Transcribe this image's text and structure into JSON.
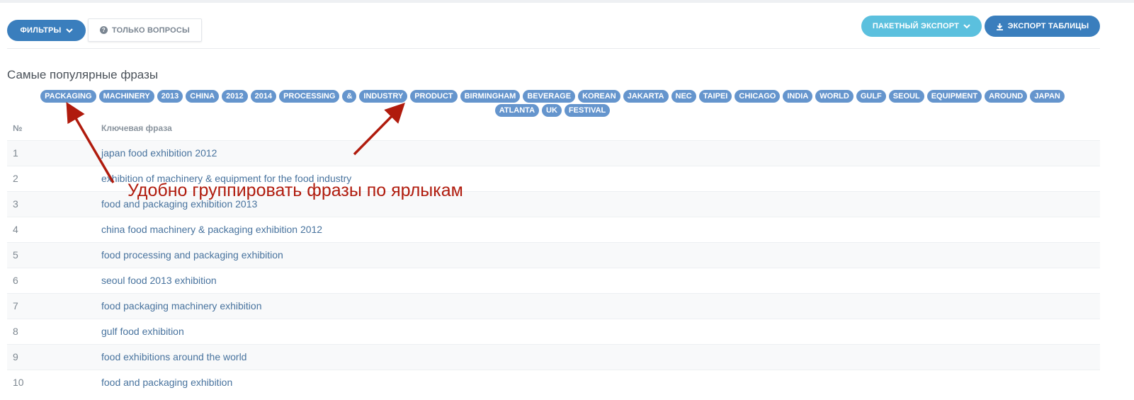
{
  "toolbar": {
    "filters_label": "ФИЛЬТРЫ",
    "questions_only_label": "ТОЛЬКО ВОПРОСЫ",
    "batch_export_label": "ПАКЕТНЫЙ ЭКСПОРТ",
    "export_table_label": "ЭКСПОРТ ТАБЛИЦЫ"
  },
  "popular": {
    "title": "Самые популярные фразы",
    "tags": [
      "PACKAGING",
      "MACHINERY",
      "2013",
      "CHINA",
      "2012",
      "2014",
      "PROCESSING",
      "&",
      "INDUSTRY",
      "PRODUCT",
      "BIRMINGHAM",
      "BEVERAGE",
      "KOREAN",
      "JAKARTA",
      "NEC",
      "TAIPEI",
      "CHICAGO",
      "INDIA",
      "WORLD",
      "GULF",
      "SEOUL",
      "EQUIPMENT",
      "AROUND",
      "JAPAN",
      "ATLANTA",
      "UK",
      "FESTIVAL"
    ]
  },
  "table": {
    "columns": [
      "№",
      "Ключевая фраза"
    ],
    "rows": [
      {
        "num": "1",
        "phrase": "japan food exhibition 2012"
      },
      {
        "num": "2",
        "phrase": "exhibition of machinery & equipment for the food industry"
      },
      {
        "num": "3",
        "phrase": "food and packaging exhibition 2013"
      },
      {
        "num": "4",
        "phrase": "china food machinery & packaging exhibition 2012"
      },
      {
        "num": "5",
        "phrase": "food processing and packaging exhibition"
      },
      {
        "num": "6",
        "phrase": "seoul food 2013 exhibition"
      },
      {
        "num": "7",
        "phrase": "food packaging machinery exhibition"
      },
      {
        "num": "8",
        "phrase": "gulf food exhibition"
      },
      {
        "num": "9",
        "phrase": "food exhibitions around the world"
      },
      {
        "num": "10",
        "phrase": "food and packaging exhibition"
      }
    ]
  },
  "annotation": {
    "text": "Удобно группировать фразы по ярлыкам",
    "color": "#b01b0d"
  },
  "colors": {
    "primary": "#3a7ebd",
    "info": "#5bc0de",
    "tag": "#6595cd",
    "link": "#48739e"
  }
}
